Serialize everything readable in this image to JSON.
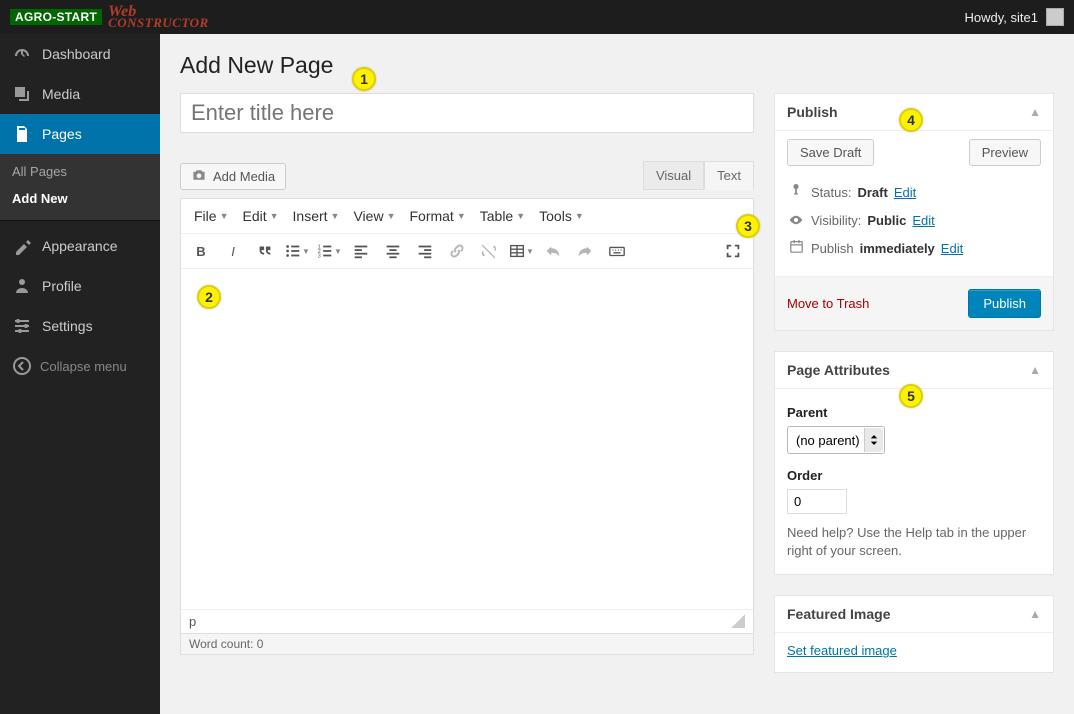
{
  "adminbar": {
    "logo_primary": "AGRO-START",
    "logo_top": "Web",
    "logo_bottom": "CONSTRUCTOR",
    "greeting": "Howdy, site1"
  },
  "sidebar": {
    "items": [
      {
        "label": "Dashboard"
      },
      {
        "label": "Media"
      },
      {
        "label": "Pages"
      },
      {
        "label": "Appearance"
      },
      {
        "label": "Profile"
      },
      {
        "label": "Settings"
      }
    ],
    "pages_submenu": [
      {
        "label": "All Pages"
      },
      {
        "label": "Add New"
      }
    ],
    "collapse": "Collapse menu"
  },
  "page": {
    "heading": "Add New Page",
    "title_placeholder": "Enter title here"
  },
  "editor": {
    "add_media": "Add Media",
    "tabs": {
      "visual": "Visual",
      "text": "Text"
    },
    "menubar": [
      "File",
      "Edit",
      "Insert",
      "View",
      "Format",
      "Table",
      "Tools"
    ],
    "path": "p",
    "word_count_label": "Word count: 0"
  },
  "publish": {
    "title": "Publish",
    "save_draft": "Save Draft",
    "preview": "Preview",
    "status_label": "Status:",
    "status_value": "Draft",
    "visibility_label": "Visibility:",
    "visibility_value": "Public",
    "schedule_label": "Publish",
    "schedule_value": "immediately",
    "edit": "Edit",
    "trash": "Move to Trash",
    "publish_btn": "Publish"
  },
  "attributes": {
    "title": "Page Attributes",
    "parent_label": "Parent",
    "parent_value": "(no parent)",
    "order_label": "Order",
    "order_value": "0",
    "help_text": "Need help? Use the Help tab in the upper right of your screen."
  },
  "featured": {
    "title": "Featured Image",
    "link": "Set featured image"
  },
  "badges": [
    "1",
    "2",
    "3",
    "4",
    "5"
  ]
}
